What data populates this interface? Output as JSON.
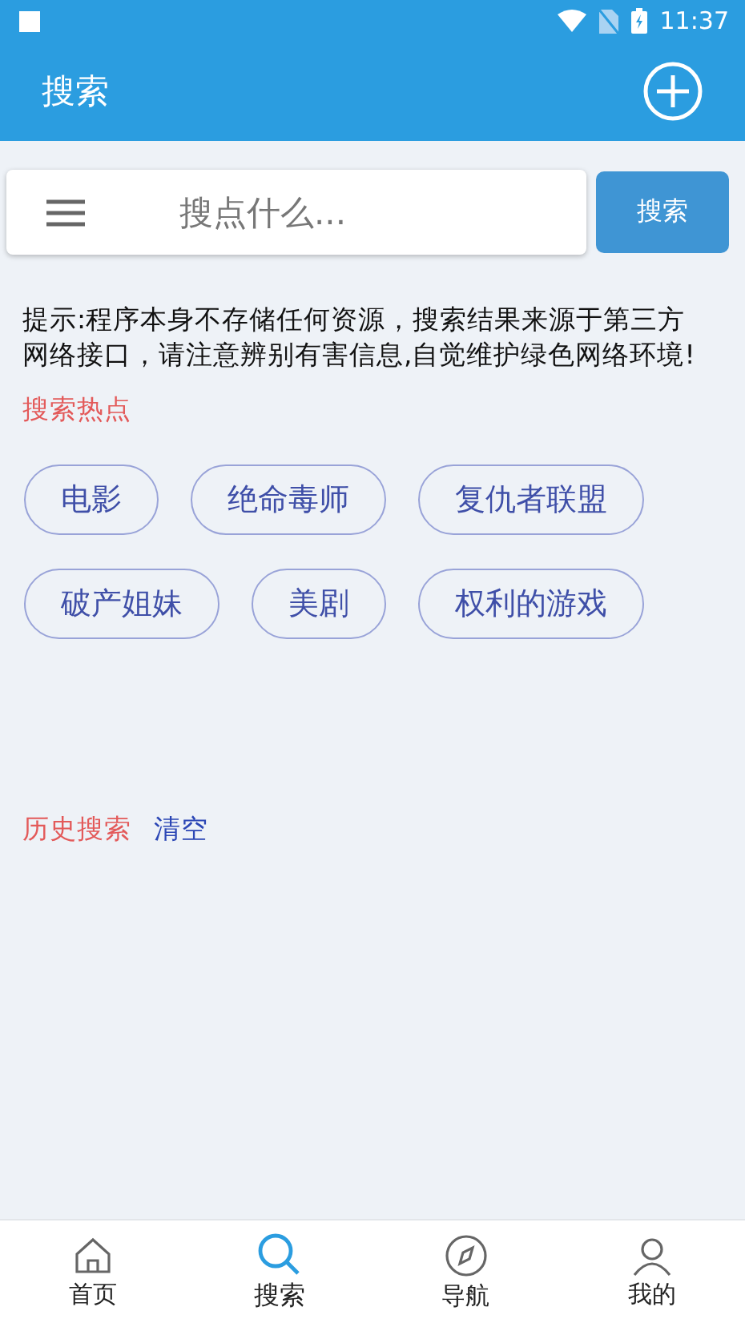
{
  "status_bar": {
    "time": "11:37"
  },
  "app_bar": {
    "title": "搜索"
  },
  "search": {
    "placeholder": "搜点什么...",
    "button": "搜索"
  },
  "notice": "提示:程序本身不存储任何资源，搜索结果来源于第三方网络接口，请注意辨别有害信息,自觉维护绿色网络环境!",
  "hot": {
    "title": "搜索热点",
    "tags": [
      "电影",
      "绝命毒师",
      "复仇者联盟",
      "破产姐妹",
      "美剧",
      "权利的游戏"
    ]
  },
  "history": {
    "title": "历史搜索",
    "clear": "清空"
  },
  "tabs": [
    {
      "label": "首页",
      "kind": "home",
      "selected": false
    },
    {
      "label": "搜索",
      "kind": "search",
      "selected": true
    },
    {
      "label": "导航",
      "kind": "compass",
      "selected": false
    },
    {
      "label": "我的",
      "kind": "person",
      "selected": false
    }
  ]
}
